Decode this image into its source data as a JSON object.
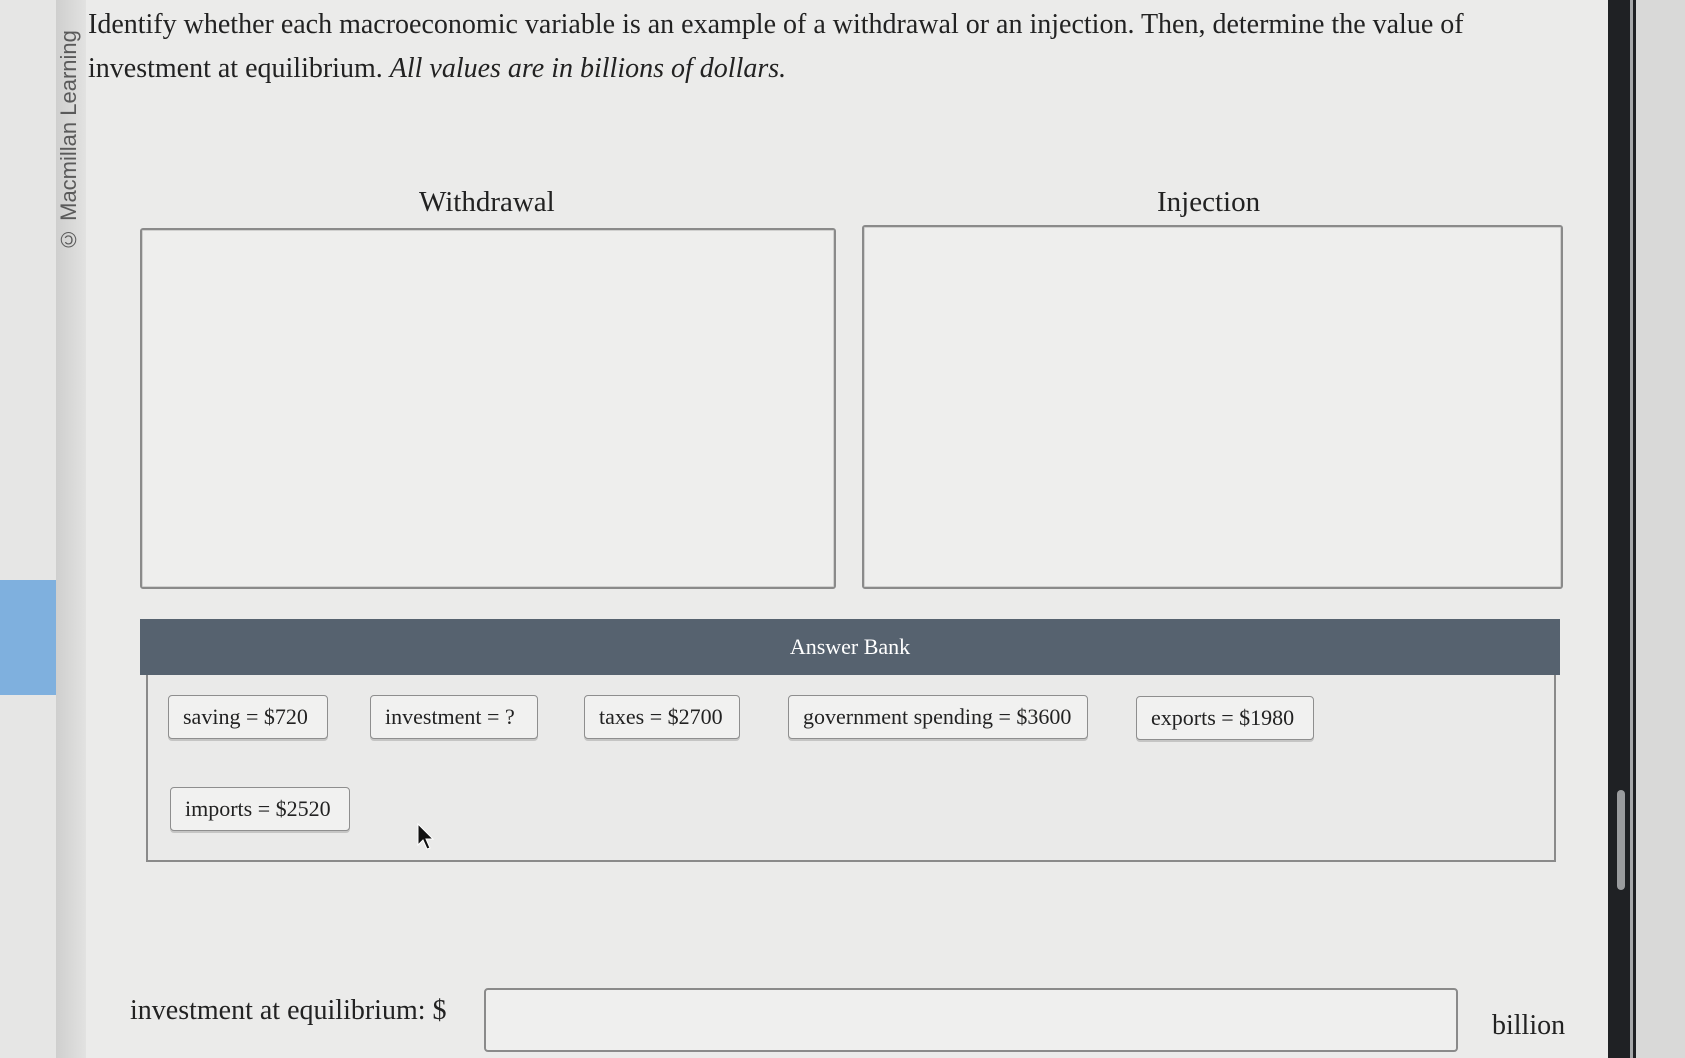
{
  "watermark": "© Macmillan Learning",
  "question": {
    "text": "Identify whether each macroeconomic variable is an example of a withdrawal or an injection. Then, determine the value of investment at equilibrium.",
    "note": "All values are in billions of dollars."
  },
  "zones": {
    "withdrawal": "Withdrawal",
    "injection": "Injection"
  },
  "answer_bank": {
    "title": "Answer Bank",
    "items": [
      "saving = $720",
      "investment = ?",
      "taxes = $2700",
      "government spending = $3600",
      "exports = $1980",
      "imports = $2520"
    ]
  },
  "equilibrium": {
    "label": "investment at equilibrium: $",
    "value": "",
    "unit": "billion"
  },
  "colors": {
    "bank_header": "#56626f",
    "left_accent": "#7fb0de",
    "right_bezel": "#1f2124"
  }
}
